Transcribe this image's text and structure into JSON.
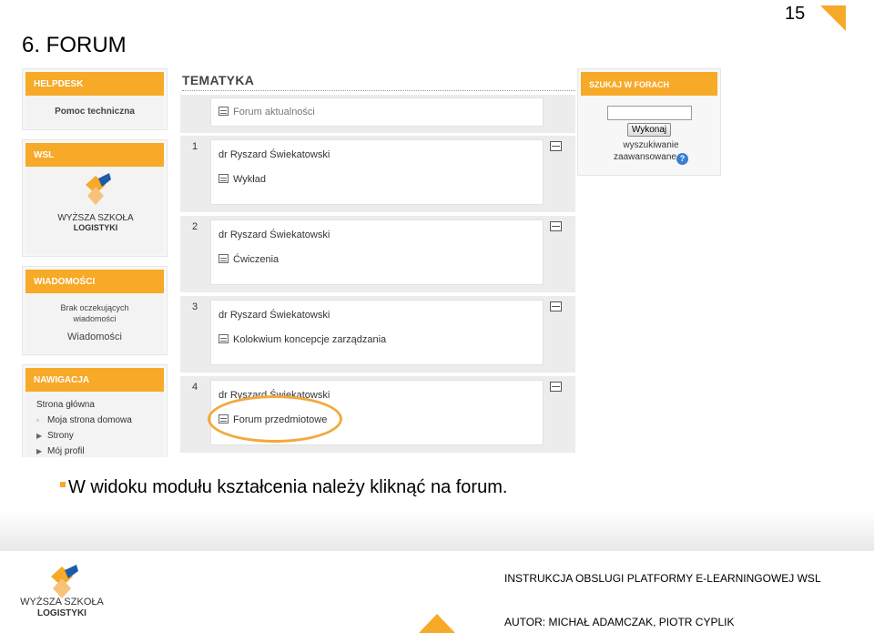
{
  "slide": {
    "title": "6. FORUM",
    "page_number": "15",
    "caption": "W widoku modułu kształcenia należy kliknąć na forum."
  },
  "left_blocks": {
    "helpdesk": {
      "header": "HELPDESK",
      "link": "Pomoc techniczna"
    },
    "wsl": {
      "header": "WSL",
      "logo_line1": "WYŻSZA SZKOŁA",
      "logo_line2": "LOGISTYKI"
    },
    "messages": {
      "header": "WIADOMOŚCI",
      "empty_line1": "Brak oczekujących",
      "empty_line2": "wiadomości",
      "link": "Wiadomości"
    },
    "navigation": {
      "header": "NAWIGACJA",
      "items": [
        {
          "label": "Strona główna",
          "bullet": ""
        },
        {
          "label": "Moja strona domowa",
          "bullet": "▫"
        },
        {
          "label": "Strony",
          "bullet": "▶"
        },
        {
          "label": "Mój profil",
          "bullet": "▶"
        }
      ]
    }
  },
  "main": {
    "heading": "TEMATYKA",
    "news_forum": "Forum aktualności",
    "sections": [
      {
        "number": "1",
        "teacher": "dr Ryszard Świekatowski",
        "activity": "Wykład"
      },
      {
        "number": "2",
        "teacher": "dr Ryszard Świekatowski",
        "activity": "Ćwiczenia"
      },
      {
        "number": "3",
        "teacher": "dr Ryszard Świekatowski",
        "activity": "Kolokwium koncepcje zarządzania"
      },
      {
        "number": "4",
        "teacher": "dr Ryszard Świekatowski",
        "activity": "Forum przedmiotowe"
      }
    ]
  },
  "search_block": {
    "header": "SZUKAJ W FORACH",
    "input_value": "",
    "button_label": "Wykonaj",
    "advanced_line1": "wyszukiwanie",
    "advanced_line2": "zaawansowane",
    "help_glyph": "?"
  },
  "footer": {
    "line1": "INSTRUKCJA OBSLUGI PLATFORMY E-LEARNINGOWEJ WSL",
    "line2": "AUTOR: MICHAŁ ADAMCZAK, PIOTR CYPLIK",
    "logo_line1": "WYŻSZA SZKOŁA",
    "logo_line2": "LOGISTYKI"
  },
  "colors": {
    "accent": "#f7a928",
    "highlight": "#f2a93b"
  }
}
